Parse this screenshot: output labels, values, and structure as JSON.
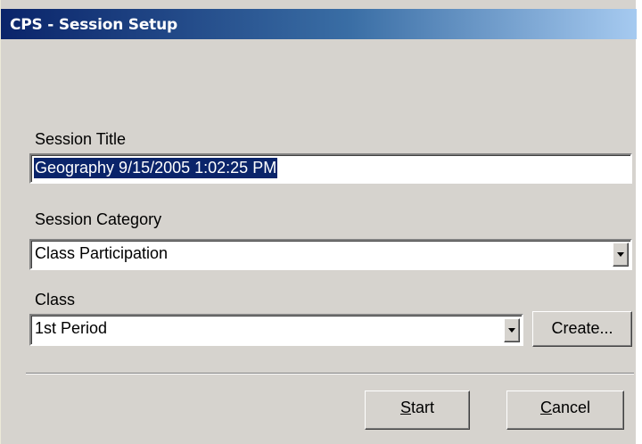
{
  "window": {
    "title": "CPS - Session Setup"
  },
  "session_title": {
    "label": "Session Title",
    "value": "Geography 9/15/2005 1:02:25 PM"
  },
  "session_category": {
    "label": "Session Category",
    "selected": "Class Participation"
  },
  "class": {
    "label": "Class",
    "selected": "1st Period",
    "create_label": "Create..."
  },
  "buttons": {
    "start_hotkey": "S",
    "start_rest": "tart",
    "cancel_hotkey": "C",
    "cancel_rest": "ancel"
  },
  "icons": {
    "dropdown": "chevron-down-icon"
  },
  "colors": {
    "titlebar_start": "#0a246a",
    "titlebar_end": "#a6caf0",
    "dialog_bg": "#d6d3ce",
    "selection": "#0a246a"
  }
}
